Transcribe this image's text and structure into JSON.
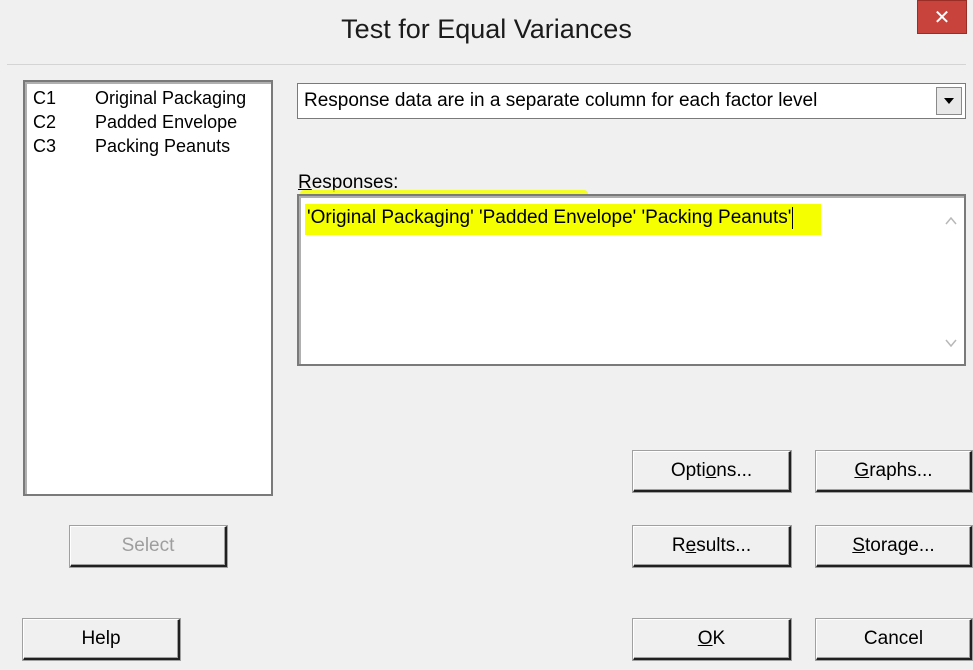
{
  "window": {
    "title": "Test for Equal Variances",
    "close_symbol": "✕"
  },
  "variables": [
    {
      "id": "C1",
      "name": "Original Packaging"
    },
    {
      "id": "C2",
      "name": "Padded Envelope"
    },
    {
      "id": "C3",
      "name": "Packing Peanuts"
    }
  ],
  "layout_select": {
    "selected": "Response data are in a separate column for each factor level"
  },
  "responses": {
    "label_mnemonic": "R",
    "label_rest": "esponses:",
    "value": "'Original Packaging' 'Padded Envelope' 'Packing Peanuts'"
  },
  "buttons": {
    "select": "Select",
    "options_pre": "Opti",
    "options_key": "o",
    "options_post": "ns...",
    "graphs_key": "G",
    "graphs_post": "raphs...",
    "results_pre": "R",
    "results_key": "e",
    "results_post": "sults...",
    "storage_key": "S",
    "storage_post": "torage...",
    "help": "Help",
    "ok_key": "O",
    "ok_post": "K",
    "cancel": "Cancel"
  },
  "colors": {
    "highlight": "#f5ff00",
    "close_red": "#c7433b"
  }
}
